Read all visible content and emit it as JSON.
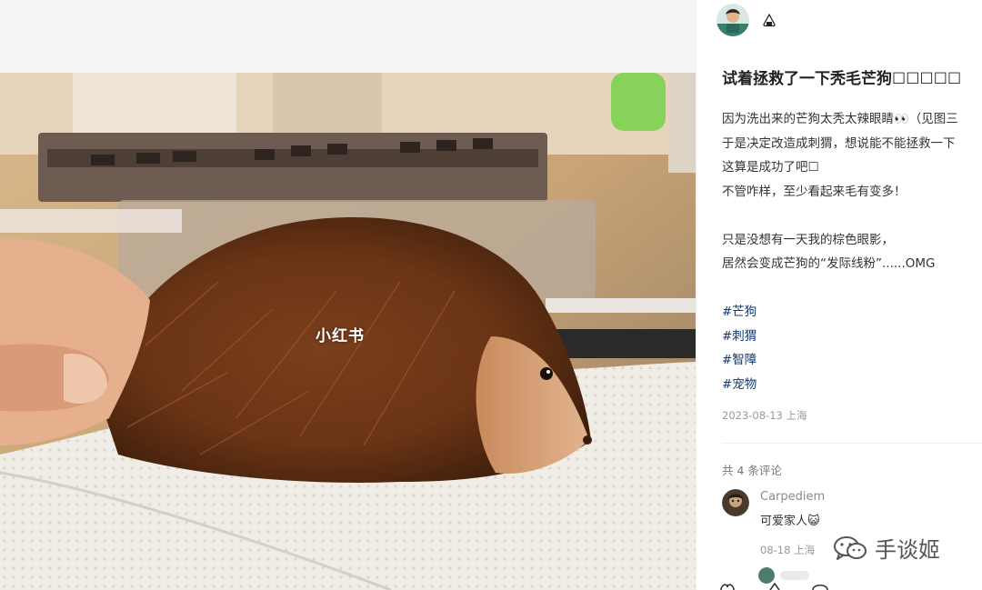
{
  "note": {
    "image_watermark": "小红书"
  },
  "author": {
    "avatar_icon": "author-avatar",
    "badge_icon": "onigiri-badge-icon"
  },
  "post": {
    "title": "试着拯救了一下秃毛芒狗☐☐☐☐☐",
    "body_lines": [
      "因为洗出来的芒狗太秃太辣眼睛👀（见图三",
      "于是决定改造成刺猬，想说能不能拯救一下",
      "这算是成功了吧☐",
      "不管咋样，至少看起来毛有变多！",
      "",
      "只是没想有一天我的棕色眼影，",
      "居然会变成芒狗的“发际线粉”......OMG"
    ],
    "tags": [
      "#芒狗",
      "#刺猬",
      "#智障",
      "#宠物"
    ],
    "date_location": "2023-08-13 上海"
  },
  "comments": {
    "count_label": "共 4 条评论",
    "items": [
      {
        "user": "Carpediem",
        "text": "可爱家人😺",
        "meta": "08-18 上海"
      }
    ]
  },
  "overlay_watermark": {
    "text": "手谈姬",
    "icon": "wechat-icon"
  },
  "colors": {
    "tag": "#13386c",
    "meta": "#999999"
  }
}
